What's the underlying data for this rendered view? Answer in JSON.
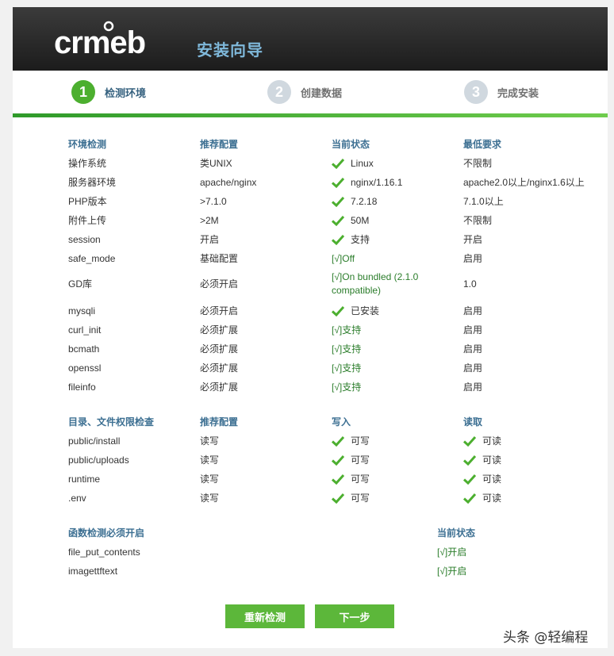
{
  "header": {
    "logo_text": "crmeb",
    "title": "安装向导"
  },
  "steps": [
    {
      "num": "1",
      "label": "检测环境"
    },
    {
      "num": "2",
      "label": "创建数据"
    },
    {
      "num": "3",
      "label": "完成安装"
    }
  ],
  "env": {
    "headers": [
      "环境检测",
      "推荐配置",
      "当前状态",
      "最低要求"
    ],
    "rows": [
      {
        "name": "操作系统",
        "rec": "类UNIX",
        "status": "Linux",
        "min": "不限制"
      },
      {
        "name": "服务器环境",
        "rec": "apache/nginx",
        "status": "nginx/1.16.1",
        "min": "apache2.0以上/nginx1.6以上"
      },
      {
        "name": "PHP版本",
        "rec": ">7.1.0",
        "status": "7.2.18",
        "min": "7.1.0以上"
      },
      {
        "name": "附件上传",
        "rec": ">2M",
        "status": "50M",
        "min": "不限制"
      },
      {
        "name": "session",
        "rec": "开启",
        "status": "支持",
        "min": "开启"
      },
      {
        "name": "safe_mode",
        "rec": "基础配置",
        "status": "[√]Off",
        "min": "启用"
      },
      {
        "name": "GD库",
        "rec": "必须开启",
        "status": "[√]On bundled (2.1.0 compatible)",
        "min": "1.0"
      },
      {
        "name": "mysqli",
        "rec": "必须开启",
        "status": "已安装",
        "min": "启用"
      },
      {
        "name": "curl_init",
        "rec": "必须扩展",
        "status": "[√]支持",
        "min": "启用"
      },
      {
        "name": "bcmath",
        "rec": "必须扩展",
        "status": "[√]支持",
        "min": "启用"
      },
      {
        "name": "openssl",
        "rec": "必须扩展",
        "status": "[√]支持",
        "min": "启用"
      },
      {
        "name": "fileinfo",
        "rec": "必须扩展",
        "status": "[√]支持",
        "min": "启用"
      }
    ]
  },
  "dirs": {
    "headers": [
      "目录、文件权限检查",
      "推荐配置",
      "写入",
      "读取"
    ],
    "rows": [
      {
        "name": "public/install",
        "rec": "读写",
        "write": "可写",
        "read": "可读"
      },
      {
        "name": "public/uploads",
        "rec": "读写",
        "write": "可写",
        "read": "可读"
      },
      {
        "name": "runtime",
        "rec": "读写",
        "write": "可写",
        "read": "可读"
      },
      {
        "name": ".env",
        "rec": "读写",
        "write": "可写",
        "read": "可读"
      }
    ]
  },
  "funcs": {
    "headers": [
      "函数检测必须开启",
      "当前状态"
    ],
    "rows": [
      {
        "name": "file_put_contents",
        "status": "[√]开启"
      },
      {
        "name": "imagettftext",
        "status": "[√]开启"
      }
    ]
  },
  "buttons": {
    "recheck": "重新检测",
    "next": "下一步"
  },
  "watermark": "头条 @轻编程",
  "colors": {
    "accent_green": "#5cb73a",
    "header_blue": "#3c6f92",
    "title_blue": "#7fb8da"
  }
}
